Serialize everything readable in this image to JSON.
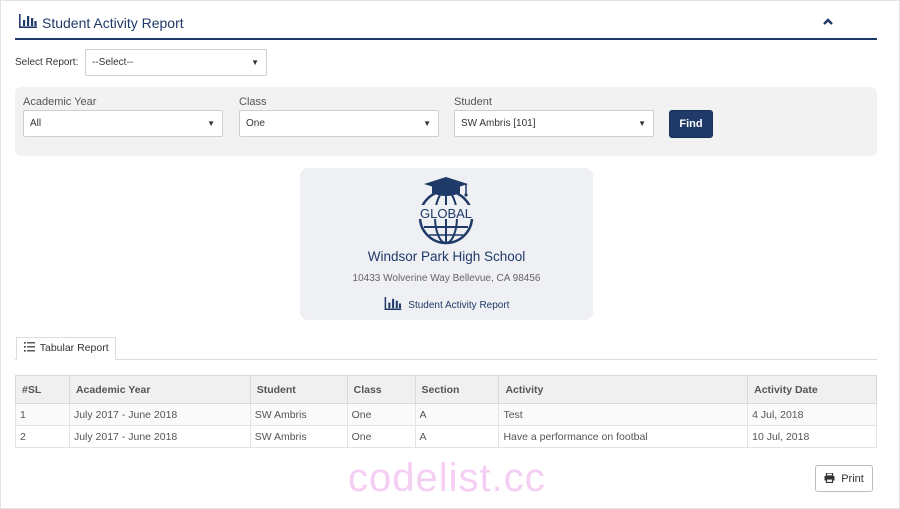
{
  "header": {
    "title": "Student Activity Report",
    "title_icon": "bar-chart-icon",
    "collapse_icon": "chevron-up-icon"
  },
  "report_selector": {
    "label": "Select Report:",
    "value": "--Select--"
  },
  "filters": {
    "academic_year": {
      "label": "Academic Year",
      "value": "All"
    },
    "class": {
      "label": "Class",
      "value": "One"
    },
    "student": {
      "label": "Student",
      "value": "SW Ambris [101]"
    },
    "find_label": "Find"
  },
  "school_card": {
    "logo_text": "GLOBAL",
    "logo_icon": "graduation-globe-icon",
    "name": "Windsor Park High School",
    "address": "10433 Wolverine Way Bellevue, CA 98456",
    "report_title": "Student Activity Report"
  },
  "tabs": [
    {
      "label": "Tabular Report",
      "icon": "list-icon"
    }
  ],
  "table": {
    "columns": [
      "#SL",
      "Academic Year",
      "Student",
      "Class",
      "Section",
      "Activity",
      "Activity Date"
    ],
    "rows": [
      [
        "1",
        "July 2017 - June 2018",
        "SW Ambris",
        "One",
        "A",
        "Test",
        "4 Jul, 2018"
      ],
      [
        "2",
        "July 2017 - June 2018",
        "SW Ambris",
        "One",
        "A",
        "Have a performance on footbal",
        "10 Jul, 2018"
      ]
    ]
  },
  "print_label": "Print",
  "watermark": "codelist.cc",
  "colors": {
    "brand_navy": "#1f3a68",
    "filter_bg": "#f2f2f2",
    "card_bg": "#eef0f3",
    "watermark": "#f4c6f1"
  }
}
